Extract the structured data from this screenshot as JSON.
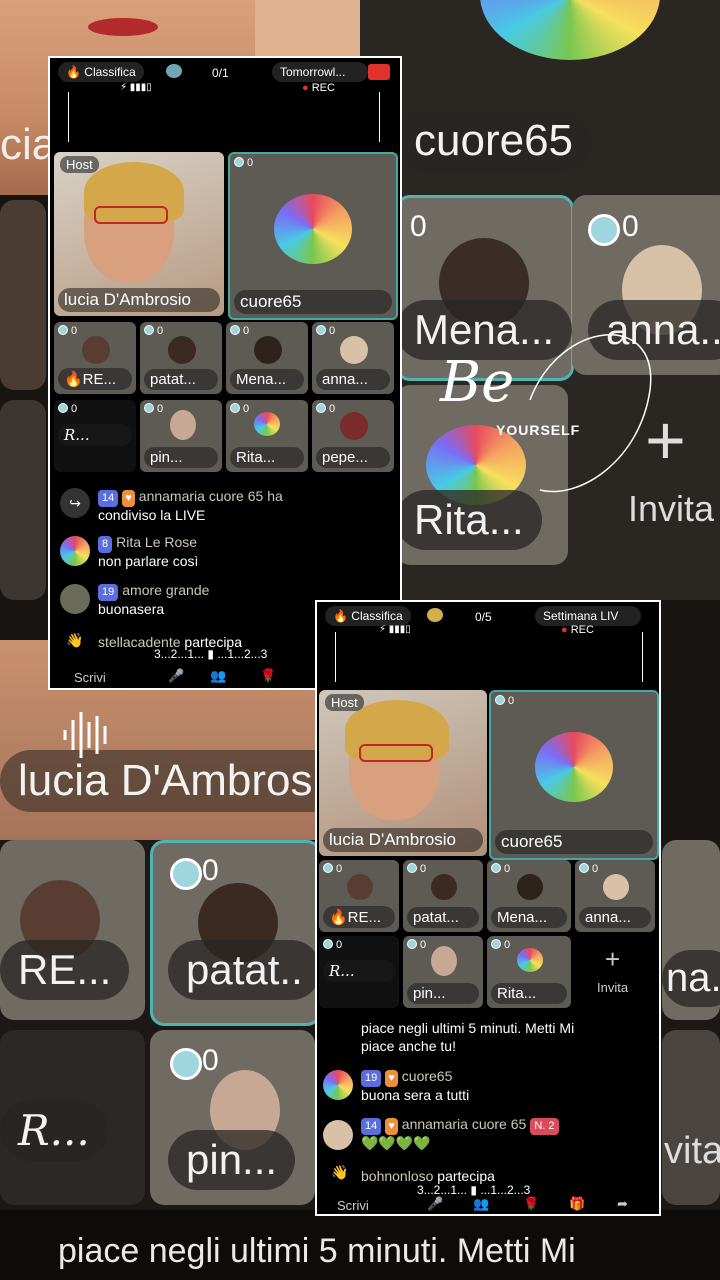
{
  "background": {
    "top_right_name": "cuore65",
    "mena": "Mena...",
    "anna": "anna..",
    "rita": "Rita...",
    "invita": "Invita",
    "count_zero": "0",
    "be": "Be",
    "yourself": "YOURSELF",
    "lucia_big": "lucia D'Ambrosio",
    "re_big": "RE...",
    "patat_big": "patat..",
    "pin_big": "pin...",
    "r_big": "R...",
    "na_big": "na..",
    "vita_big": "vita",
    "bottom_caption": "piace negli ultimi 5 minuti. Metti Mi",
    "left_cut": "cia"
  },
  "phone1": {
    "classifica": "Classifica",
    "counter": "0/1",
    "right_pill": "Tomorrowl...",
    "rec": "REC",
    "host_tag": "Host",
    "host_name": "lucia D'Ambrosio",
    "host_count": "",
    "co_name": "cuore65",
    "co_count": "0",
    "grid": [
      {
        "name": "🔥RE...",
        "count": "0"
      },
      {
        "name": "patat...",
        "count": "0"
      },
      {
        "name": "Mena...",
        "count": "0"
      },
      {
        "name": "anna...",
        "count": "0"
      },
      {
        "name": "R...",
        "count": "0"
      },
      {
        "name": "pin...",
        "count": "0"
      },
      {
        "name": "Rita...",
        "count": "0"
      },
      {
        "name": "pepe...",
        "count": "0"
      }
    ],
    "chat": [
      {
        "level": "14",
        "user": "annamaria cuore 65",
        "msg_inline": "ha",
        "msg": "condiviso la LIVE"
      },
      {
        "level": "8",
        "user": "Rita Le Rose",
        "msg": "non parlare così"
      },
      {
        "level": "19",
        "user": "amore grande",
        "msg": "buonasera"
      },
      {
        "user": "stellacadente",
        "msg_inline": "partecipa"
      }
    ],
    "countdown": "3...2...1...",
    "countdown2": "...1...2...3",
    "scrivi": "Scrivi"
  },
  "phone2": {
    "classifica": "Classifica",
    "counter": "0/5",
    "right_pill": "Settimana LIV",
    "rec": "REC",
    "host_tag": "Host",
    "host_name": "lucia D'Ambrosio",
    "co_name": "cuore65",
    "co_count": "0",
    "grid": [
      {
        "name": "🔥RE...",
        "count": "0"
      },
      {
        "name": "patat...",
        "count": "0"
      },
      {
        "name": "Mena...",
        "count": "0"
      },
      {
        "name": "anna...",
        "count": "0"
      },
      {
        "name": "R...",
        "count": "0"
      },
      {
        "name": "pin...",
        "count": "0"
      },
      {
        "name": "Rita...",
        "count": "0"
      }
    ],
    "invita": "Invita",
    "chat": [
      {
        "msg": "piace negli ultimi 5 minuti. Metti Mi"
      },
      {
        "msg": "piace anche tu!"
      },
      {
        "level": "19",
        "user": "cuore65",
        "msg": "buona sera a tutti"
      },
      {
        "level": "14",
        "user": "annamaria cuore 65",
        "badge": "N. 2",
        "msg": "💚💚💚💚"
      },
      {
        "user": "bohnonloso",
        "msg_inline": "partecipa"
      }
    ],
    "countdown": "3...2...1...",
    "countdown2": "...1...2...3",
    "scrivi": "Scrivi"
  },
  "colors": {
    "teal": "#3fa9a6",
    "level": "#5b6ee0",
    "rec": "#e0322b"
  }
}
